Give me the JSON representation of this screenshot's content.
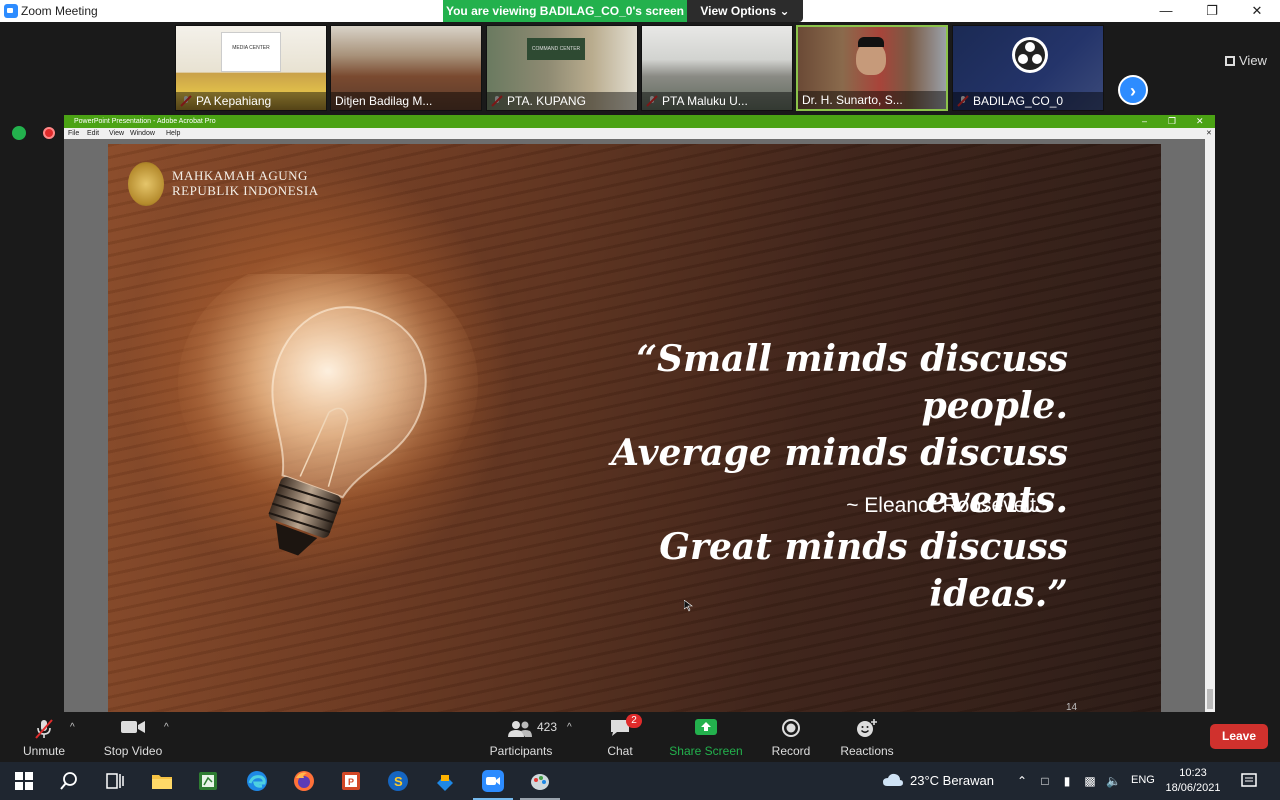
{
  "window": {
    "title": "Zoom Meeting",
    "viewing_banner": "You are viewing BADILAG_CO_0's screen",
    "view_options": "View Options",
    "view_label": "View"
  },
  "participants_strip": [
    {
      "name": "PA Kepahiang",
      "muted": true
    },
    {
      "name": "Ditjen Badilag M...",
      "muted": false
    },
    {
      "name": "PTA. KUPANG",
      "muted": true
    },
    {
      "name": "PTA Maluku U...",
      "muted": true
    },
    {
      "name": "Dr. H. Sunarto, S...",
      "muted": false,
      "active_speaker": true
    },
    {
      "name": "BADILAG_CO_0",
      "muted": true
    }
  ],
  "shared_app": {
    "title": "PowerPoint Presentation - Adobe Acrobat Pro",
    "menu": [
      "File",
      "Edit",
      "View",
      "Window",
      "Help"
    ]
  },
  "slide": {
    "org_line1": "MAHKAMAH AGUNG",
    "org_line2": "REPUBLIK INDONESIA",
    "quote_line1": "“Small minds discuss people.",
    "quote_line2": "Average minds discuss events.",
    "quote_line3": "Great minds discuss ideas.”",
    "author": "~ Eleanor Roosevelt ~",
    "page_number": "14"
  },
  "toolbar": {
    "unmute": "Unmute",
    "stop_video": "Stop Video",
    "participants_count": "423",
    "participants": "Participants",
    "chat": "Chat",
    "chat_badge": "2",
    "share_screen": "Share Screen",
    "record": "Record",
    "reactions": "Reactions",
    "leave": "Leave"
  },
  "taskbar": {
    "weather": "23°C  Berawan",
    "language": "ENG",
    "time": "10:23",
    "date": "18/06/2021"
  },
  "colors": {
    "zoom_green": "#23b14d",
    "zoom_blue": "#2d8cff",
    "leave_red": "#d0312d",
    "acrobat_green": "#4ba314"
  }
}
